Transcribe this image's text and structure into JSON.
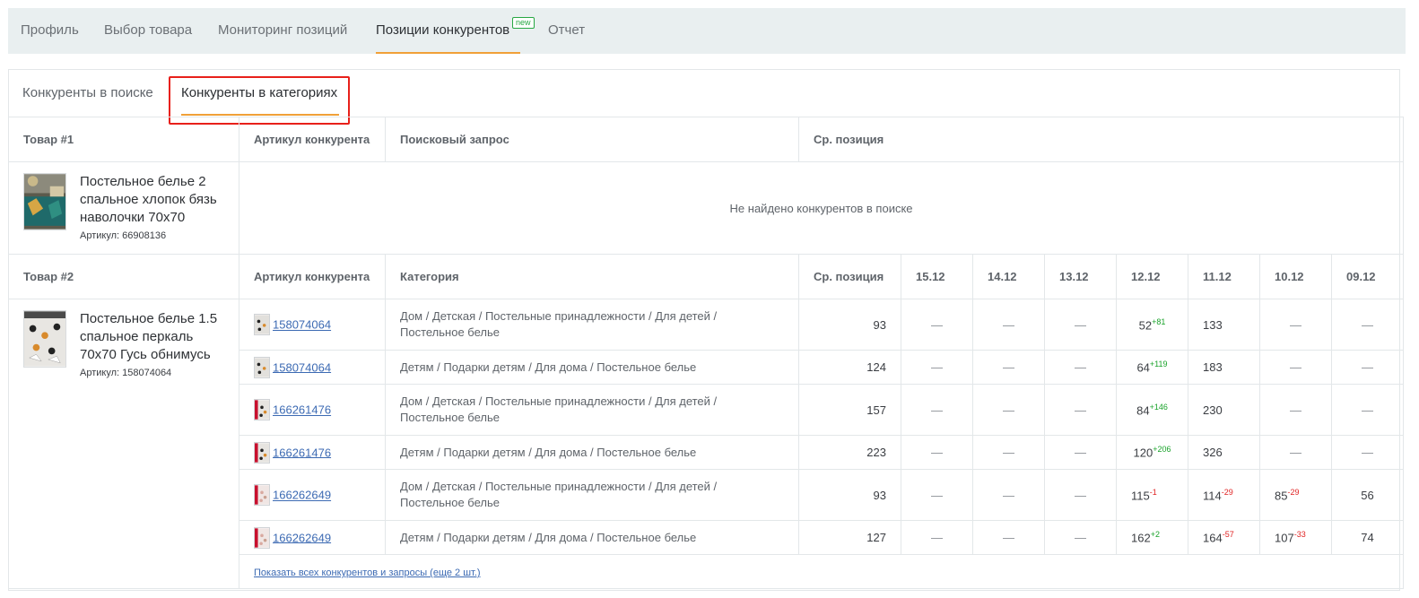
{
  "nav": {
    "items": [
      {
        "label": "Профиль"
      },
      {
        "label": "Выбор товара"
      },
      {
        "label": "Мониторинг позиций"
      },
      {
        "label": "Позиции конкурентов",
        "badge": "new",
        "active": true
      },
      {
        "label": "Отчет"
      }
    ]
  },
  "subtabs": [
    {
      "label": "Конкуренты в поиске"
    },
    {
      "label": "Конкуренты в категориях",
      "active": true
    }
  ],
  "product1": {
    "header": "Товар #1",
    "col_competitor": "Артикул конкурента",
    "col_query": "Поисковый запрос",
    "col_avg": "Ср. позиция",
    "title": "Постельное белье 2 спальное хлопок бязь наволочки 70х70",
    "sku": "Артикул: 66908136",
    "empty_message": "Не найдено конкурентов в поиске"
  },
  "product2": {
    "header": "Товар #2",
    "col_competitor": "Артикул конкурента",
    "col_category": "Категория",
    "col_avg": "Ср. позиция",
    "dates": [
      "15.12",
      "14.12",
      "13.12",
      "12.12",
      "11.12",
      "10.12",
      "09.12"
    ],
    "title": "Постельное белье 1.5 спальное перкаль 70х70 Гусь обнимусь",
    "sku": "Артикул: 158074064",
    "rows": [
      {
        "article": "158074064",
        "category": "Дом / Детская / Постельные принадлежности / Для детей / Постельное белье",
        "avg": "93",
        "cells": [
          {
            "v": "—"
          },
          {
            "v": "—"
          },
          {
            "v": "—"
          },
          {
            "v": "52",
            "d": "+81",
            "dir": "up"
          },
          {
            "v": "133"
          },
          {
            "v": "—"
          },
          {
            "v": "—"
          }
        ]
      },
      {
        "article": "158074064",
        "category": "Детям / Подарки детям / Для дома / Постельное белье",
        "avg": "124",
        "cells": [
          {
            "v": "—"
          },
          {
            "v": "—"
          },
          {
            "v": "—"
          },
          {
            "v": "64",
            "d": "+119",
            "dir": "up"
          },
          {
            "v": "183"
          },
          {
            "v": "—"
          },
          {
            "v": "—"
          }
        ]
      },
      {
        "article": "166261476",
        "category": "Дом / Детская / Постельные принадлежности / Для детей / Постельное белье",
        "avg": "157",
        "cells": [
          {
            "v": "—"
          },
          {
            "v": "—"
          },
          {
            "v": "—"
          },
          {
            "v": "84",
            "d": "+146",
            "dir": "up"
          },
          {
            "v": "230"
          },
          {
            "v": "—"
          },
          {
            "v": "—"
          }
        ]
      },
      {
        "article": "166261476",
        "category": "Детям / Подарки детям / Для дома / Постельное белье",
        "avg": "223",
        "cells": [
          {
            "v": "—"
          },
          {
            "v": "—"
          },
          {
            "v": "—"
          },
          {
            "v": "120",
            "d": "+206",
            "dir": "up"
          },
          {
            "v": "326"
          },
          {
            "v": "—"
          },
          {
            "v": "—"
          }
        ]
      },
      {
        "article": "166262649",
        "category": "Дом / Детская / Постельные принадлежности / Для детей / Постельное белье",
        "avg": "93",
        "cells": [
          {
            "v": "—"
          },
          {
            "v": "—"
          },
          {
            "v": "—"
          },
          {
            "v": "115",
            "d": "-1",
            "dir": "down"
          },
          {
            "v": "114",
            "d": "-29",
            "dir": "down"
          },
          {
            "v": "85",
            "d": "-29",
            "dir": "down"
          },
          {
            "v": "56"
          }
        ]
      },
      {
        "article": "166262649",
        "category": "Детям / Подарки детям / Для дома / Постельное белье",
        "avg": "127",
        "cells": [
          {
            "v": "—"
          },
          {
            "v": "—"
          },
          {
            "v": "—"
          },
          {
            "v": "162",
            "d": "+2",
            "dir": "up"
          },
          {
            "v": "164",
            "d": "-57",
            "dir": "down"
          },
          {
            "v": "107",
            "d": "-33",
            "dir": "down"
          },
          {
            "v": "74"
          }
        ]
      }
    ],
    "show_all": "Показать всех конкурентов и запросы (еще 2 шт.)"
  },
  "colors": {
    "accent": "#f0a038",
    "highlight": "#e8201a",
    "link": "#3c6ab3",
    "up": "#1aa32b",
    "down": "#e02424",
    "nav_bg": "#e9eff0"
  }
}
